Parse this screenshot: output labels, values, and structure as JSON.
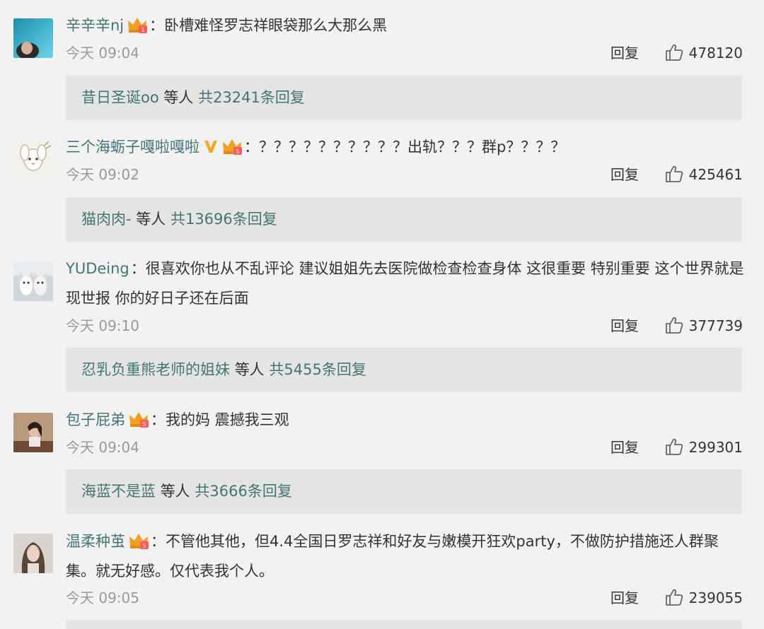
{
  "comments": [
    {
      "user": "辛辛辛nj",
      "text": "卧槽难怪罗志祥眼袋那么大那么黑",
      "time": "今天 09:04",
      "reply_label": "回复",
      "likes": "478120",
      "reply_summary": {
        "name": "昔日圣诞oo",
        "mid": "等人",
        "count": "共23241条回复"
      }
    },
    {
      "user": "三个海蛎子嘎啦嘎啦",
      "text": "？？？？？？？？？？出轨？？？群p？？？？",
      "time": "今天 09:02",
      "reply_label": "回复",
      "likes": "425461",
      "reply_summary": {
        "name": "猫肉肉-",
        "mid": "等人",
        "count": "共13696条回复"
      }
    },
    {
      "user": "YUDeing",
      "text": "很喜欢你也从不乱评论 建议姐姐先去医院做检查检查身体 这很重要 特别重要 这个世界就是现世报 你的好日子还在后面",
      "time": "今天 09:10",
      "reply_label": "回复",
      "likes": "377739",
      "reply_summary": {
        "name": "忍乳负重熊老师的姐妹",
        "mid": "等人",
        "count": "共5455条回复"
      }
    },
    {
      "user": "包子屁弟",
      "text": "我的妈 震撼我三观",
      "time": "今天 09:04",
      "reply_label": "回复",
      "likes": "299301",
      "reply_summary": {
        "name": "海蓝不是蓝",
        "mid": "等人",
        "count": "共3666条回复"
      }
    },
    {
      "user": "温柔种茧",
      "text": "不管他其他，但4.4全国日罗志祥和好友与嫩模开狂欢party，不做防护措施还人群聚集。就无好感。仅代表我个人。",
      "time": "今天 09:05",
      "reply_label": "回复",
      "likes": "239055"
    }
  ],
  "colors": {
    "background": "#f2f2f2",
    "username": "#447575",
    "reply_box": "#e4e4e4",
    "crown": "#f0a020",
    "verified": "#f5a623"
  }
}
